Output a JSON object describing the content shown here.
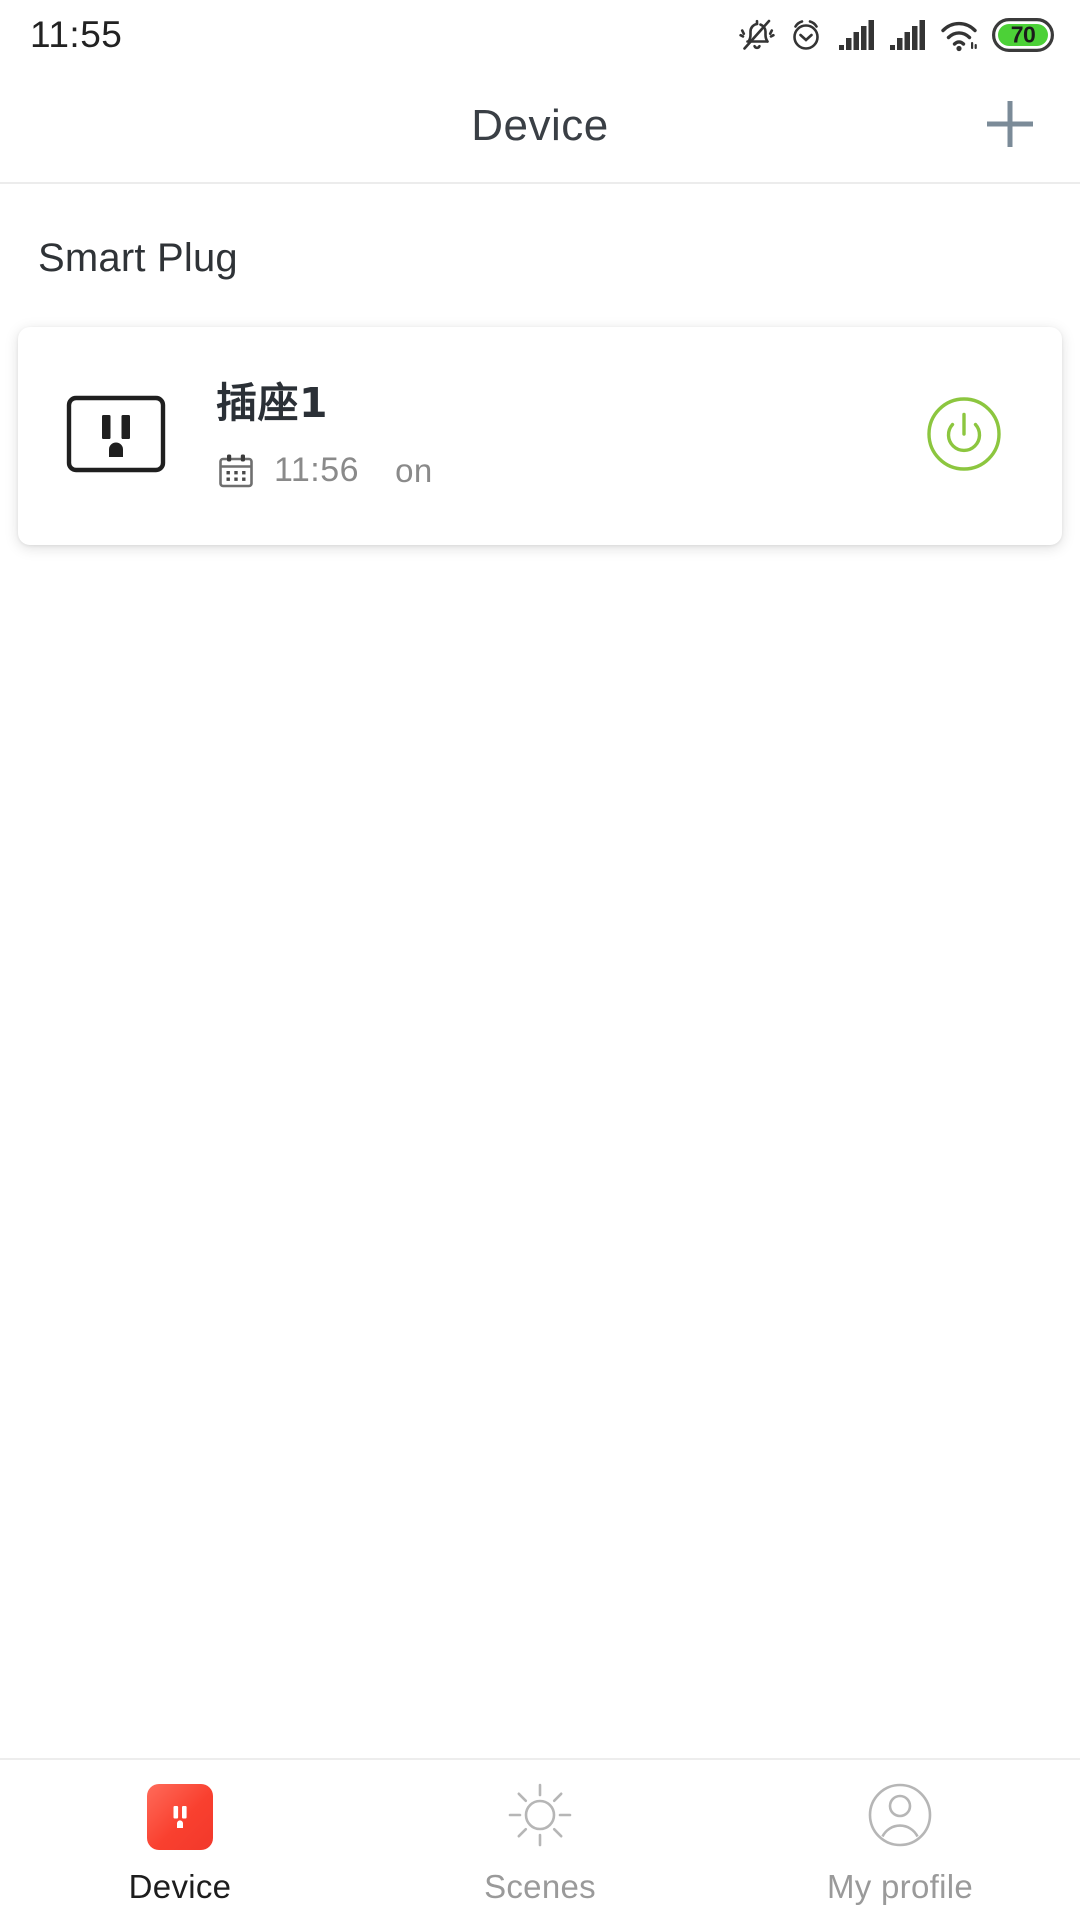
{
  "statusbar": {
    "time": "11:55",
    "battery_level": "70",
    "battery_color": "#4cd137",
    "icons": [
      "bell-muted-icon",
      "alarm-clock-icon",
      "signal-bars-icon",
      "signal-bars-icon",
      "wifi-icon",
      "battery-icon"
    ]
  },
  "header": {
    "title": "Device",
    "add_icon": "plus-icon",
    "add_icon_color": "#7b8b98"
  },
  "main": {
    "section_title": "Smart Plug",
    "devices": [
      {
        "icon": "power-outlet-icon",
        "name": "插座1",
        "schedule_icon": "calendar-icon",
        "schedule_time": "11:56",
        "state_label": "on",
        "toggle_icon": "power-button-icon",
        "toggle_color": "#8cc63f",
        "toggle_on": true
      }
    ]
  },
  "bottomnav": {
    "items": [
      {
        "label": "Device",
        "icon": "power-outlet-icon",
        "active": true
      },
      {
        "label": "Scenes",
        "icon": "sun-icon",
        "active": false
      },
      {
        "label": "My profile",
        "icon": "user-circle-icon",
        "active": false
      }
    ]
  }
}
